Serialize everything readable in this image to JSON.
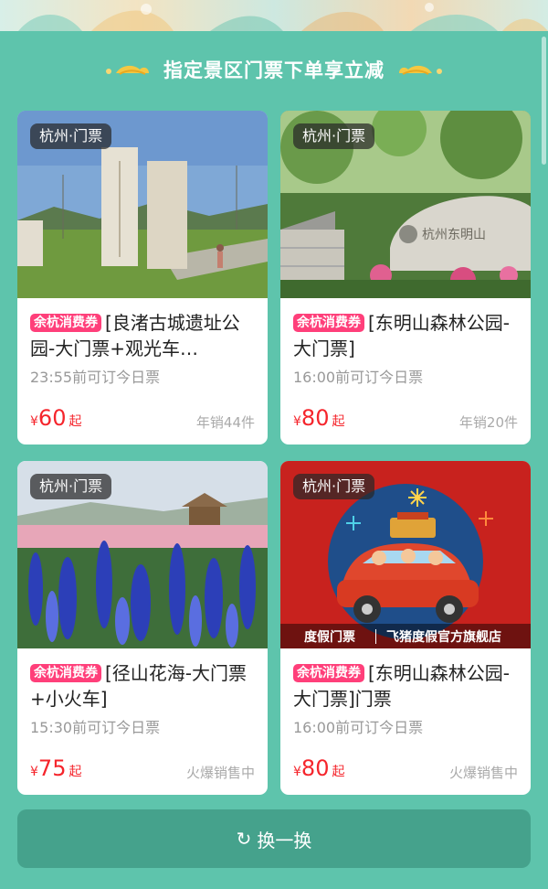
{
  "headline": "指定景区门票下单享立减",
  "coupon_label": "余杭消费券",
  "cards": [
    {
      "city_tag": "杭州·门票",
      "title": "[良渚古城遗址公园-大门票+观光车…",
      "book_time": "23:55前可订今日票",
      "price_symbol": "¥",
      "price": "60",
      "price_suffix": "起",
      "sales": "年销44件"
    },
    {
      "city_tag": "杭州·门票",
      "title": "[东明山森林公园-大门票]",
      "book_time": "16:00前可订今日票",
      "price_symbol": "¥",
      "price": "80",
      "price_suffix": "起",
      "sales": "年销20件"
    },
    {
      "city_tag": "杭州·门票",
      "title": "[径山花海-大门票+小火车]",
      "book_time": "15:30前可订今日票",
      "price_symbol": "¥",
      "price": "75",
      "price_suffix": "起",
      "sales": "火爆销售中"
    },
    {
      "city_tag": "杭州·门票",
      "title": "[东明山森林公园-大门票]门票",
      "book_time": "16:00前可订今日票",
      "price_symbol": "¥",
      "price": "80",
      "price_suffix": "起",
      "sales": "火爆销售中",
      "image_caption_left": "度假门票",
      "image_caption_right": "飞猪度假官方旗舰店"
    }
  ],
  "refresh_label": "换一换",
  "refresh_icon": "refresh-icon",
  "colors": {
    "background": "#5ec4ac",
    "refresh_button": "#45a28c",
    "coupon": "#ff3f7a",
    "price": "#f5252c"
  }
}
